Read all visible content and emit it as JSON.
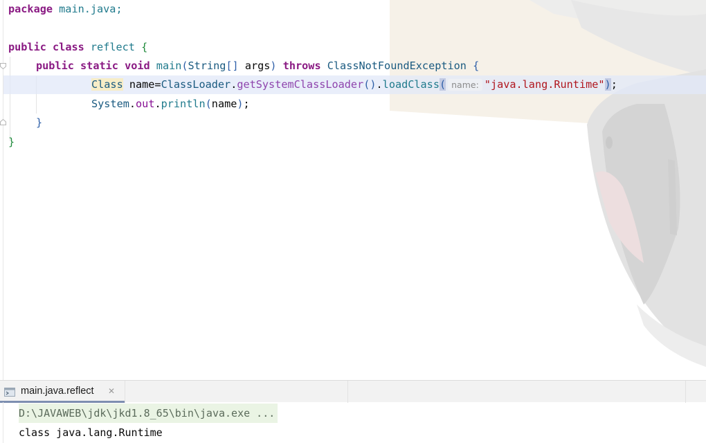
{
  "editor": {
    "lines": {
      "l1": {
        "kw": "package",
        "rest": " main.java;"
      },
      "l3": {
        "kw1": "public",
        "kw2": "class",
        "name": "reflect",
        "brace": "{"
      },
      "l4": {
        "kw1": "public",
        "kw2": "static",
        "kw3": "void",
        "method": "main",
        "p1": "(",
        "type": "String",
        "arr": "[]",
        "arg": " args",
        "p2": ")",
        "kw4": "throws",
        "exc": "ClassNotFoundException",
        "brace": "{"
      },
      "l5": {
        "type": "Class",
        "var": " name=",
        "loader": "ClassLoader",
        "dot1": ".",
        "get": "getSystemClassLoader",
        "pp": "()",
        "dot2": ".",
        "load": "loadClass",
        "open": "(",
        "hint": "name:",
        "str": "\"java.lang.Runtime\"",
        "close": ")",
        "semi": ";"
      },
      "l6": {
        "sys": "System",
        "dot1": ".",
        "out": "out",
        "dot2": ".",
        "println": "println",
        "open": "(",
        "arg": "name",
        "close": ")",
        "semi": ";"
      },
      "l7": {
        "brace": "}"
      },
      "l8": {
        "brace": "}"
      }
    }
  },
  "run_panel": {
    "tab_label": "main.java.reflect",
    "tab_close": "✕",
    "tab_icon": "console-icon",
    "console": {
      "command": "D:\\JAVAWEB\\jdk\\jkd1.8_65\\bin\\java.exe ...",
      "output": "class java.lang.Runtime"
    }
  },
  "colors": {
    "keyword": "#8a1a83",
    "type": "#1a5a80",
    "method": "#8e44ad",
    "string": "#b0161e",
    "brace": "#1e8a3a",
    "caret_row": "#e1e8f8",
    "console_cmd_bg": "#eaf4e4"
  }
}
